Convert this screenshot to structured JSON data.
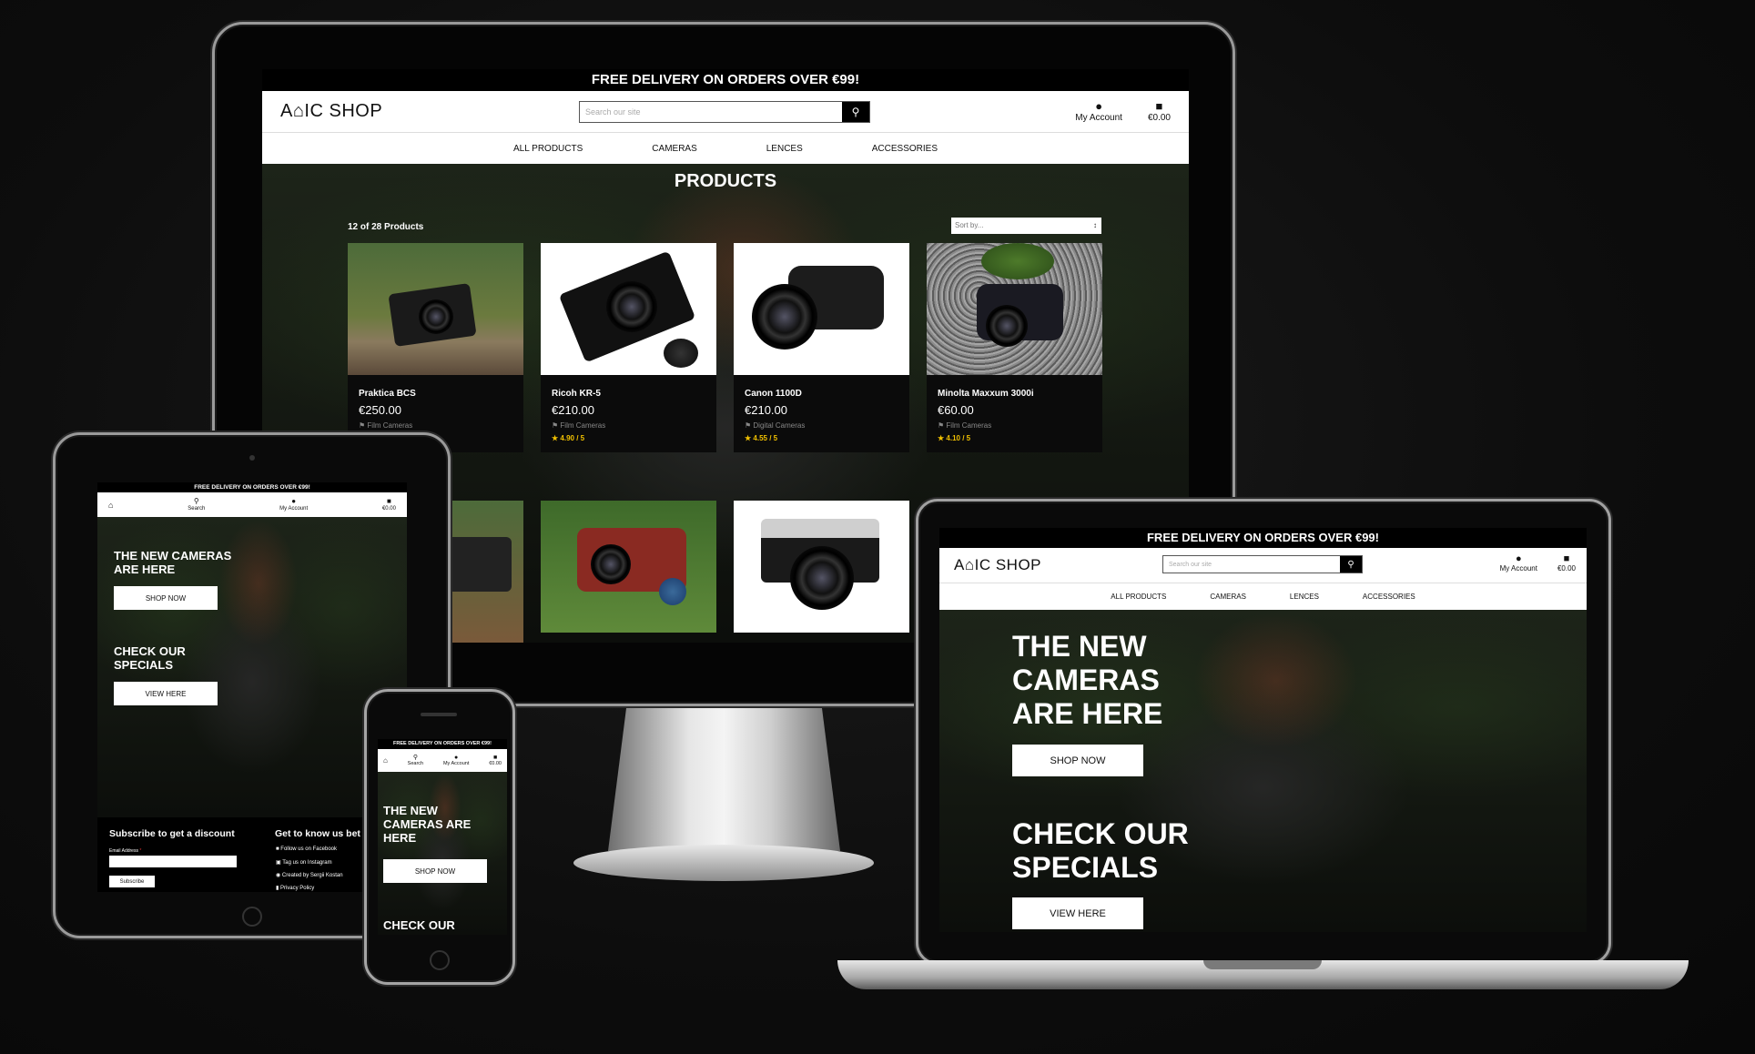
{
  "promo": "FREE DELIVERY ON ORDERS OVER €99!",
  "logo": "A⌂IC SHOP",
  "search_placeholder": "Search our site",
  "account_label": "My Account",
  "cart_total": "€0.00",
  "search_label": "Search",
  "nav": [
    "ALL PRODUCTS",
    "CAMERAS",
    "LENCES",
    "ACCESSORIES"
  ],
  "products_page": {
    "title": "PRODUCTS",
    "count_text": "12 of 28 Products",
    "sort_placeholder": "Sort by..."
  },
  "products": [
    {
      "name": "Praktica BCS",
      "price": "€250.00",
      "category": "Film Cameras",
      "rating": ""
    },
    {
      "name": "Ricoh KR-5",
      "price": "€210.00",
      "category": "Film Cameras",
      "rating": "4.90 / 5"
    },
    {
      "name": "Canon 1100D",
      "price": "€210.00",
      "category": "Digital Cameras",
      "rating": "4.55 / 5"
    },
    {
      "name": "Minolta Maxxum 3000i",
      "price": "€60.00",
      "category": "Film Cameras",
      "rating": "4.10 / 5"
    }
  ],
  "hero": {
    "new_title": "THE NEW CAMERAS ARE HERE",
    "shop_now": "SHOP NOW",
    "specials_title": "CHECK OUR SPECIALS",
    "view_here": "VIEW HERE",
    "check_our": "CHECK OUR"
  },
  "footer": {
    "subscribe_title": "Subscribe to get a discount",
    "email_label": "Email Address",
    "required_mark": "*",
    "subscribe_button": "Subscribe",
    "know_title": "Get to know us bet",
    "links": [
      "Follow us on Facebook",
      "Tag us on Instagram",
      "Created by Sergii Kostan",
      "Privacy Policy"
    ]
  },
  "icons": {
    "search": "search-icon",
    "account": "user-icon",
    "cart": "shopping-bag-icon",
    "star": "star-icon",
    "tag": "tag-icon"
  },
  "colors": {
    "background": "#111111",
    "rating": "#f0c000",
    "button_bg": "#ffffff"
  }
}
